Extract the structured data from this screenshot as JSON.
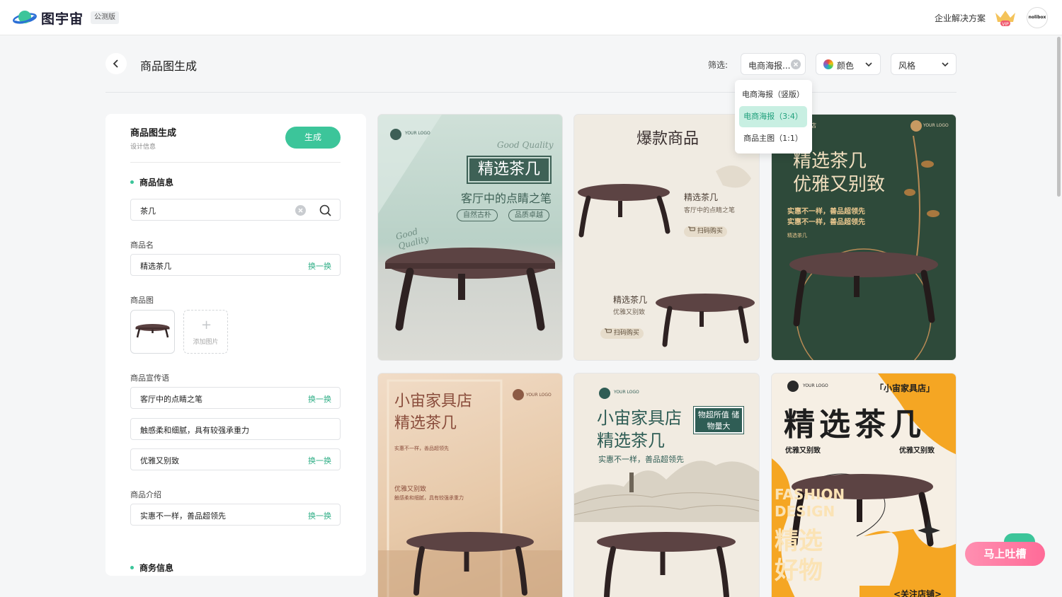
{
  "topbar": {
    "brand": "图宇宙",
    "beta": "公测版",
    "enterprise": "企业解决方案",
    "vip_badge": "VIP",
    "avatar_text": "nolibox"
  },
  "header": {
    "title": "商品图生成",
    "filter_label": "筛选:",
    "filter_type_value": "电商海报...",
    "filter_color_label": "颜色",
    "filter_style_label": "风格"
  },
  "dropdown": {
    "options": [
      "电商海报（竖版）",
      "电商海报（3:4）",
      "商品主图（1:1）"
    ],
    "selected_index": 1
  },
  "panel": {
    "title": "商品图生成",
    "subtitle": "设计信息",
    "generate_label": "生成",
    "section_product": "商品信息",
    "search_value": "茶几",
    "name_label": "商品名",
    "name_value": "精选茶几",
    "swap_label": "换一换",
    "image_label": "商品图",
    "add_image_label": "添加图片",
    "slogan_label": "商品宣传语",
    "slogans": [
      "客厅中的点睛之笔",
      "触感柔和细腻，具有较强承重力",
      "优雅又别致"
    ],
    "intro_label": "商品介绍",
    "intro_value": "实惠不一样，善品超领先",
    "section_business": "商务信息"
  },
  "cards": {
    "c1": {
      "logo": "YOUR LOGO",
      "good_quality": "Good Quality",
      "title": "精选茶几",
      "subtitle": "客厅中的点睛之笔",
      "tag1": "自然古朴",
      "tag2": "品质卓越",
      "script": "Good Quality"
    },
    "c2": {
      "headline": "爆款商品",
      "name1": "精选茶几",
      "sub1": "客厅中的点睛之笔",
      "buy": "扫码购买",
      "name2": "精选茶几",
      "sub2": "优雅又别致"
    },
    "c3": {
      "logo": "YOUR LOGO",
      "corner": "店",
      "line1": "精选茶几",
      "line2": "优雅又别致",
      "promo1": "实惠不一样，善品超领先",
      "promo2": "实惠不一样，善品超领先",
      "small": "精选茶几"
    },
    "c4": {
      "logo": "YOUR LOGO",
      "line1": "小宙家具店",
      "line2": "精选茶几",
      "promo": "实惠不一样，善品超领先",
      "sub": "优雅又别致",
      "desc": "触感柔和细腻，具有较强承重力"
    },
    "c5": {
      "logo": "YOUR LOGO",
      "line1": "小宙家具店",
      "line2": "精选茶几",
      "box": "物超所值 储物量大",
      "promo": "实惠不一样，善品超领先"
    },
    "c6": {
      "logo": "YOUR LOGO",
      "shop": "「小宙家具店」",
      "title": "精选茶几",
      "left": "优雅又别致",
      "right": "优雅又别致",
      "bg1": "FASHION",
      "bg2": "DESIGN",
      "bg3": "精选",
      "bg4": "好物",
      "follow": "<关注店铺>"
    }
  },
  "feedback": {
    "label": "马上吐槽"
  },
  "colors": {
    "accent": "#3cc59a",
    "accent_text": "#2fae86",
    "selected_bg": "#c8efe2"
  }
}
